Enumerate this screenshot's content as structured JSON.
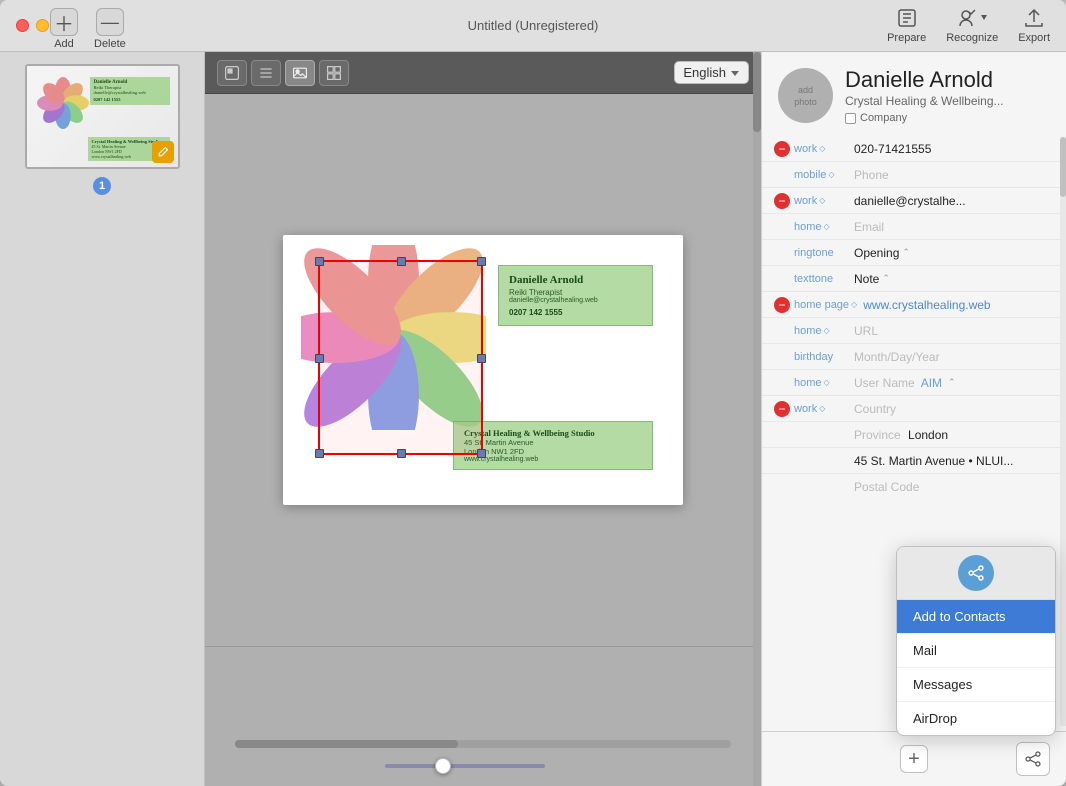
{
  "window": {
    "title": "Untitled (Unregistered)"
  },
  "toolbar": {
    "add_label": "Add",
    "delete_label": "Delete",
    "prepare_label": "Prepare",
    "recognize_label": "Recognize",
    "export_label": "Export"
  },
  "canvas_toolbar": {
    "tools": [
      "⊞",
      "☰",
      "⬜",
      "⊟"
    ],
    "language_label": "English"
  },
  "contact": {
    "name": "Danielle Arnold",
    "company": "Crystal Healing & Wellbeing...",
    "company_checkbox": "Company",
    "avatar_label": "add",
    "avatar_sublabel": "photo",
    "fields": [
      {
        "minus": true,
        "label": "work",
        "value": "020-71421555",
        "placeholder": ""
      },
      {
        "minus": false,
        "label": "mobile",
        "value": "",
        "placeholder": "Phone"
      },
      {
        "minus": true,
        "label": "work",
        "value": "danielle@crystalhe...",
        "placeholder": ""
      },
      {
        "minus": false,
        "label": "home",
        "value": "",
        "placeholder": "Email"
      },
      {
        "minus": false,
        "label": "ringtone",
        "value": "Opening",
        "placeholder": ""
      },
      {
        "minus": false,
        "label": "texttone",
        "value": "Note",
        "placeholder": ""
      },
      {
        "minus": true,
        "label": "home page",
        "value": "www.crystalhealing.web",
        "placeholder": ""
      },
      {
        "minus": false,
        "label": "home",
        "value": "",
        "placeholder": "URL"
      },
      {
        "minus": false,
        "label": "birthday",
        "value": "",
        "placeholder": "Month/Day/Year"
      },
      {
        "minus": false,
        "label": "home",
        "value": "User Name  AIM",
        "placeholder": ""
      },
      {
        "minus": true,
        "label": "work",
        "value": "Country",
        "placeholder": ""
      },
      {
        "minus": false,
        "label": "",
        "value": "Province  London",
        "placeholder": ""
      },
      {
        "minus": false,
        "label": "",
        "value": "45 St. Martin Avenue • NLUI...",
        "placeholder": ""
      },
      {
        "minus": false,
        "label": "",
        "value": "Postal Code",
        "placeholder": ""
      }
    ]
  },
  "business_card": {
    "name": "Danielle Arnold",
    "role": "Reiki Therapist",
    "email": "danielle@crystalhealing.web",
    "phone": "0207 142 1555",
    "company": "Crystal Healing & Wellbeing Studio",
    "address1": "45 St. Martin Avenue",
    "address2": "London NW1 2FD",
    "website": "www.crystalhealing.web"
  },
  "share_menu": {
    "add_to_contacts": "Add to Contacts",
    "mail": "Mail",
    "messages": "Messages",
    "airdrop": "AirDrop"
  },
  "sidebar": {
    "page_number": "1"
  }
}
